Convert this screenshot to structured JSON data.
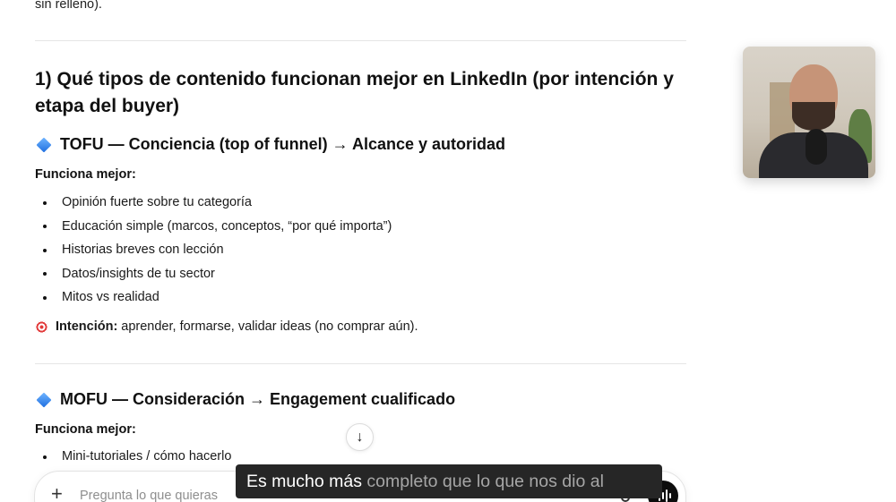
{
  "article": {
    "top_fragment": "sin relleno).",
    "section_title": "1) Qué tipos de contenido funcionan mejor en LinkedIn (por intención y etapa del buyer)",
    "tofu": {
      "heading": "TOFU — Conciencia (top of funnel) → Alcance y autoridad",
      "works_best_label": "Funciona mejor:",
      "items": [
        "Opinión fuerte sobre tu categoría",
        "Educación simple (marcos, conceptos, “por qué importa”)",
        "Historias breves con lección",
        "Datos/insights de tu sector",
        "Mitos vs realidad"
      ],
      "intent_label": "Intención:",
      "intent_text": "aprender, formarse, validar ideas (no comprar aún)."
    },
    "mofu": {
      "heading": "MOFU — Consideración → Engagement cualificado",
      "works_best_label": "Funciona mejor:",
      "items": [
        "Mini-tutoriales / cómo hacerlo"
      ]
    }
  },
  "composer": {
    "placeholder": "Pregunta lo que quieras"
  },
  "subtitle": {
    "spoken": "Es mucho más",
    "pending": " completo que lo que nos dio al"
  },
  "icons": {
    "section_marker": "blue-diamond-icon",
    "intent_marker": "target-icon",
    "scroll": "arrow-down-icon",
    "add": "plus-icon",
    "dictate": "microphone-icon",
    "voice": "voice-mode-icon"
  }
}
